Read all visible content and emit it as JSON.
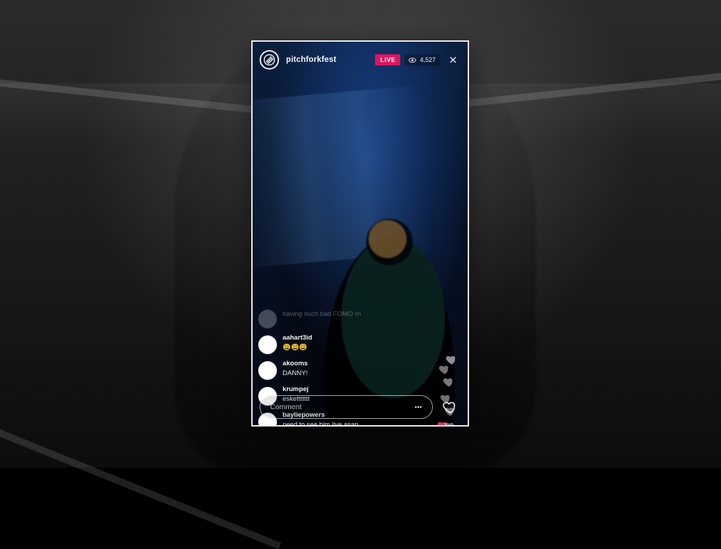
{
  "stream": {
    "account": "pitchforkfest",
    "live_label": "LIVE",
    "viewer_count": "4,527",
    "comment_placeholder": "Comment"
  },
  "comments": [
    {
      "username": "",
      "message": "having such bad FOMO rn",
      "faded": true
    },
    {
      "username": "aahart3id",
      "message": "😩😩😩",
      "faded": false
    },
    {
      "username": "akooms",
      "message": "DANNY!",
      "faded": false
    },
    {
      "username": "krumpej",
      "message": "eskettttttt",
      "faded": false
    },
    {
      "username": "bayliepowers",
      "message": "need to see him live asap",
      "faded": false
    }
  ],
  "colors": {
    "live_badge": "#e0145f",
    "heart_red": "#ff3b5c"
  },
  "icons": {
    "logo": "pitchfork-logo-icon",
    "eye": "eye-icon",
    "close": "close-icon",
    "more": "more-options-icon",
    "heart": "heart-icon"
  }
}
